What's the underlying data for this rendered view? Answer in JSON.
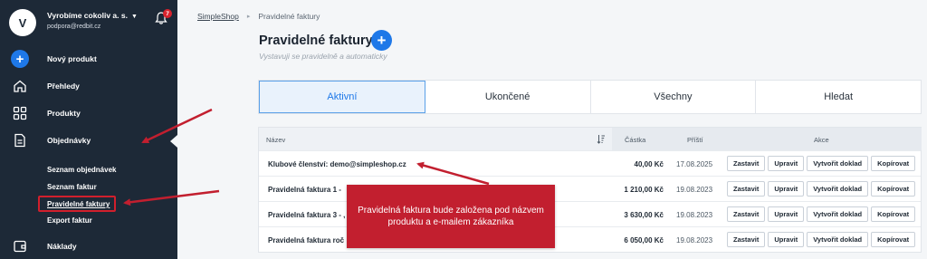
{
  "sidebar": {
    "avatar_letter": "V",
    "company": "Vyrobíme cokoliv a. s.",
    "email": "podpora@redbit.cz",
    "notification_count": "7",
    "items": [
      {
        "label": "Nový produkt",
        "icon": "plus-circle-icon"
      },
      {
        "label": "Přehledy",
        "icon": "home-icon"
      },
      {
        "label": "Produkty",
        "icon": "grid-icon"
      },
      {
        "label": "Objednávky",
        "icon": "document-icon"
      },
      {
        "label": "Náklady",
        "icon": "wallet-icon"
      }
    ],
    "subitems": [
      {
        "label": "Seznam objednávek"
      },
      {
        "label": "Seznam faktur"
      },
      {
        "label": "Pravidelné faktury"
      },
      {
        "label": "Export faktur"
      }
    ]
  },
  "breadcrumb": {
    "root": "SimpleShop",
    "current": "Pravidelné faktury"
  },
  "header": {
    "title": "Pravidelné faktury",
    "subtitle": "Vystavuji se pravidelně a automaticky"
  },
  "tabs": [
    {
      "label": "Aktivní",
      "active": true
    },
    {
      "label": "Ukončené",
      "active": false
    },
    {
      "label": "Všechny",
      "active": false
    },
    {
      "label": "Hledat",
      "active": false
    }
  ],
  "table": {
    "columns": {
      "name": "Název",
      "amount": "Částka",
      "next": "Příští",
      "actions": "Akce"
    },
    "action_labels": {
      "stop": "Zastavit",
      "edit": "Upravit",
      "create": "Vytvořit doklad",
      "copy": "Kopírovat"
    },
    "rows": [
      {
        "name": "Klubové členství: demo@simpleshop.cz",
        "amount": "40,00 Kč",
        "date": "17.08.2025"
      },
      {
        "name": "Pravidelná faktura 1 -",
        "amount": "1 210,00 Kč",
        "date": "19.08.2023"
      },
      {
        "name": "Pravidelná faktura 3 - ,",
        "amount": "3 630,00 Kč",
        "date": "19.08.2023"
      },
      {
        "name": "Pravidelná faktura roč",
        "amount": "6 050,00 Kč",
        "date": "19.08.2023"
      }
    ]
  },
  "callout": {
    "text": "Pravidelná faktura bude založena pod názvem produktu a e-mailem zákazníka"
  },
  "colors": {
    "sidebar_bg": "#1d2937",
    "accent": "#1e78e8",
    "annotation_red": "#c21f2f"
  }
}
